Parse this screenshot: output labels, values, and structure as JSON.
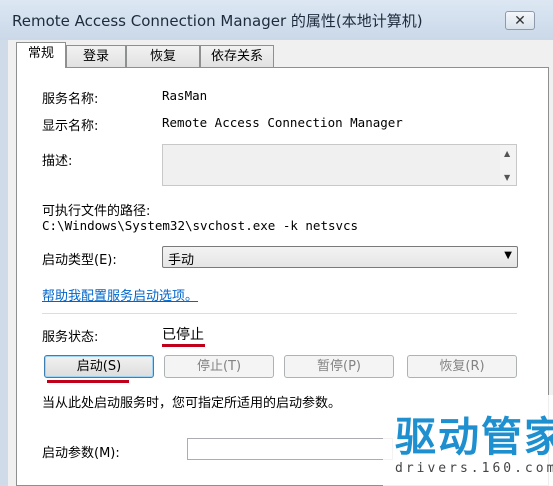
{
  "window": {
    "title": "Remote Access Connection Manager 的属性(本地计算机)",
    "close_label": "✕"
  },
  "tabs": [
    "常规",
    "登录",
    "恢复",
    "依存关系"
  ],
  "general": {
    "service_name_label": "服务名称:",
    "service_name_value": "RasMan",
    "display_name_label": "显示名称:",
    "display_name_value": "Remote Access Connection Manager",
    "description_label": "描述:",
    "path_label": "可执行文件的路径:",
    "path_value": "C:\\Windows\\System32\\svchost.exe -k netsvcs",
    "startup_type_label": "启动类型(E):",
    "startup_type_value": "手动",
    "help_link": "帮助我配置服务启动选项。",
    "service_status_label": "服务状态:",
    "service_status_value": "已停止",
    "buttons": {
      "start": "启动(S)",
      "stop": "停止(T)",
      "pause": "暂停(P)",
      "resume": "恢复(R)"
    },
    "hint_text": "当从此处启动服务时，您可指定所适用的启动参数。",
    "start_params_label": "启动参数(M):",
    "start_params_value": ""
  },
  "watermark": {
    "brand_cn": "驱动管家",
    "brand_url": "drivers.160.com"
  },
  "colors": {
    "link": "#0066cc",
    "highlight_underline": "#c0001a",
    "watermark": "#1e8fcf"
  }
}
